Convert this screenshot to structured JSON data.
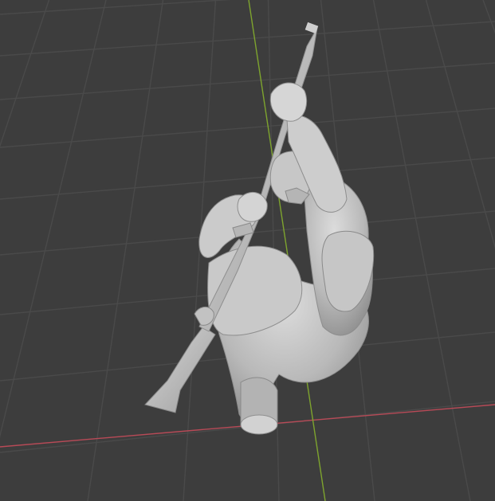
{
  "app": {
    "viewport": "3D Viewport"
  },
  "scene": {
    "object": "soldier-with-rifle-sculpt",
    "object_color": "#bdbdbd",
    "background_color": "#3d3d3d",
    "grid_color": "#4b4b4b",
    "x_axis_color": "#b84a57",
    "y_axis_color": "#7ea42e"
  }
}
